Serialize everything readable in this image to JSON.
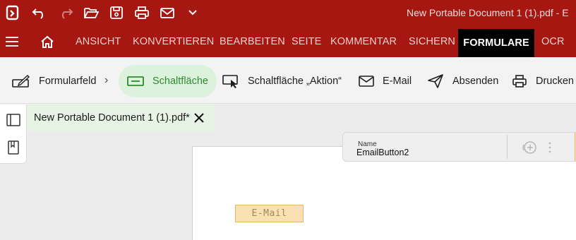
{
  "app": {
    "window_title": "New Portable Document 1 (1).pdf  -  E"
  },
  "quick_access": {
    "icons": [
      "app-logo-icon",
      "undo-icon",
      "redo-icon",
      "open-folder-icon",
      "save-icon",
      "print-icon",
      "email-icon",
      "chevron-down-icon"
    ]
  },
  "ribbon": {
    "tabs": [
      "ANSICHT",
      "KONVERTIEREN",
      "BEARBEITEN",
      "SEITE",
      "KOMMENTAR",
      "SICHERN",
      "FORMULARE",
      "OCR"
    ],
    "active_tab": "FORMULARE"
  },
  "toolbar": {
    "formularfeld": "Formularfeld",
    "schaltflaeche": "Schaltfläche",
    "schaltflaeche_aktion": "Schaltfläche „Aktion“",
    "email": "E-Mail",
    "absenden": "Absenden",
    "drucken": "Drucken"
  },
  "document": {
    "tab_title": "New Portable Document 1 (1).pdf*",
    "form_button_label": "E-Mail"
  },
  "properties": {
    "name_label": "Name",
    "name_value": "EmailButton2"
  },
  "colors": {
    "brand_red": "#a61712",
    "active_tab_bg": "#000000",
    "selected_tool_bg": "#dcf2dc",
    "selected_tool_text": "#2f8a2f",
    "form_button_bg": "#fae0b2"
  }
}
